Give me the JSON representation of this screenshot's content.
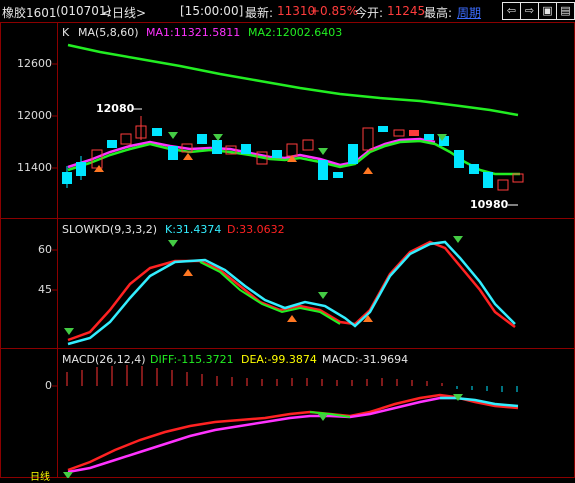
{
  "header": {
    "symbol": "橡胶1601",
    "code": "(010701)",
    "period": "<日线>",
    "time": "[15:00:00]",
    "latest_label": "最新:",
    "latest_value": "11310",
    "change_pct": "+0.85%",
    "open_label": "今开:",
    "open_value": "11245",
    "high_label": "最高:",
    "high_link": "周期",
    "nav_icons": [
      "prev-icon",
      "next-icon",
      "zoom-in-icon",
      "zoom-out-icon"
    ],
    "nav_glyphs": [
      "⇦",
      "⇨",
      "▣",
      "▤"
    ]
  },
  "kline": {
    "prefix": "K",
    "ma_title": "MA(5,8,60)",
    "ma1": "MA1:11321.5811",
    "ma2": "MA2:12002.6403",
    "y_ticks": [
      "12600",
      "12000",
      "11400"
    ],
    "high_marker": "12080",
    "low_marker": "10980"
  },
  "kd": {
    "title": "SLOWKD(9,3,3,2)",
    "k": "K:31.4374",
    "d": "D:33.0632",
    "y_ticks": [
      "60",
      "45"
    ]
  },
  "macd": {
    "title": "MACD(26,12,4)",
    "diff": "DIFF:-115.3721",
    "dea": "DEA:-99.3874",
    "macd": "MACD:-31.9694",
    "y_ticks": [
      "0"
    ]
  },
  "bottom": {
    "partial": "日线"
  },
  "colors": {
    "up": "#ff3c3c",
    "down": "#00e5ff",
    "ma_magenta": "#ff33ff",
    "ma_green": "#22ee22",
    "kd_k": "#33eeff",
    "kd_d": "#ff2222",
    "accent_yellow": "#ffff00",
    "accent_red": "#ff3333",
    "grid": "#8b0000"
  }
}
